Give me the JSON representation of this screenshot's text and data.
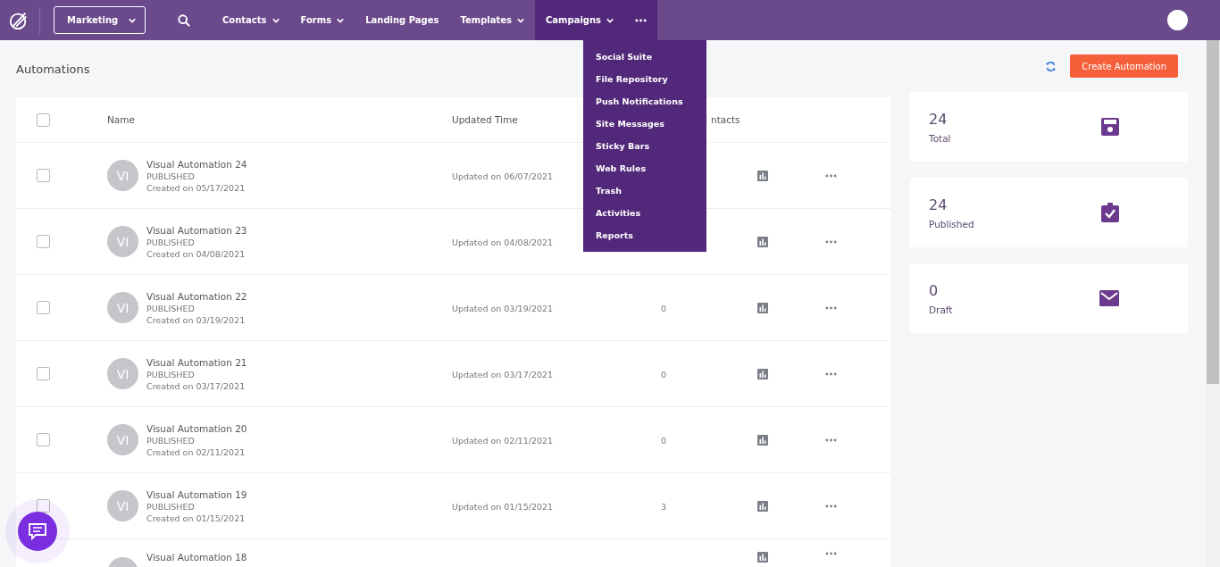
{
  "workspace": {
    "label": "Marketing"
  },
  "nav": [
    {
      "label": "Contacts",
      "dropdown": true,
      "selected": false
    },
    {
      "label": "Forms",
      "dropdown": true,
      "selected": false
    },
    {
      "label": "Landing Pages",
      "dropdown": false,
      "selected": false
    },
    {
      "label": "Templates",
      "dropdown": true,
      "selected": false
    },
    {
      "label": "Campaigns",
      "dropdown": true,
      "selected": true
    }
  ],
  "more_menu": {
    "expanded": true,
    "items": [
      "Social Suite",
      "File Repository",
      "Push Notifications",
      "Site Messages",
      "Sticky Bars",
      "Web Rules",
      "Trash",
      "Activities",
      "Reports"
    ]
  },
  "page_title": "Automations",
  "create_button": "Create Automation",
  "table": {
    "header_checked": false,
    "columns": [
      "Name",
      "Updated Time",
      "ntacts"
    ],
    "rows": [
      {
        "checked": false,
        "initials": "VI",
        "name": "Visual Automation 24",
        "status": "PUBLISHED",
        "created": "Created on 05/17/2021",
        "updated": "Updated on 06/07/2021"
      },
      {
        "checked": false,
        "initials": "VI",
        "name": "Visual Automation 23",
        "status": "PUBLISHED",
        "created": "Created on 04/08/2021",
        "updated": "Updated on 04/08/2021"
      },
      {
        "checked": false,
        "initials": "VI",
        "name": "Visual Automation 22",
        "status": "PUBLISHED",
        "created": "Created on 03/19/2021",
        "updated": "Updated on 03/19/2021",
        "contacts": "0"
      },
      {
        "checked": false,
        "initials": "VI",
        "name": "Visual Automation 21",
        "status": "PUBLISHED",
        "created": "Created on 03/17/2021",
        "updated": "Updated on 03/17/2021",
        "contacts": "0"
      },
      {
        "checked": false,
        "initials": "VI",
        "name": "Visual Automation 20",
        "status": "PUBLISHED",
        "created": "Created on 02/11/2021",
        "updated": "Updated on 02/11/2021",
        "contacts": "0"
      },
      {
        "checked": false,
        "initials": "VI",
        "name": "Visual Automation 19",
        "status": "PUBLISHED",
        "created": "Created on 01/15/2021",
        "updated": "Updated on 01/15/2021",
        "contacts": "3"
      },
      {
        "name": "Visual Automation 18"
      }
    ]
  },
  "stats": [
    {
      "value": "24",
      "label": "Total",
      "kind": "save"
    },
    {
      "value": "24",
      "label": "Published",
      "kind": "clipboard"
    },
    {
      "value": "0",
      "label": "Draft",
      "kind": "mail"
    }
  ]
}
